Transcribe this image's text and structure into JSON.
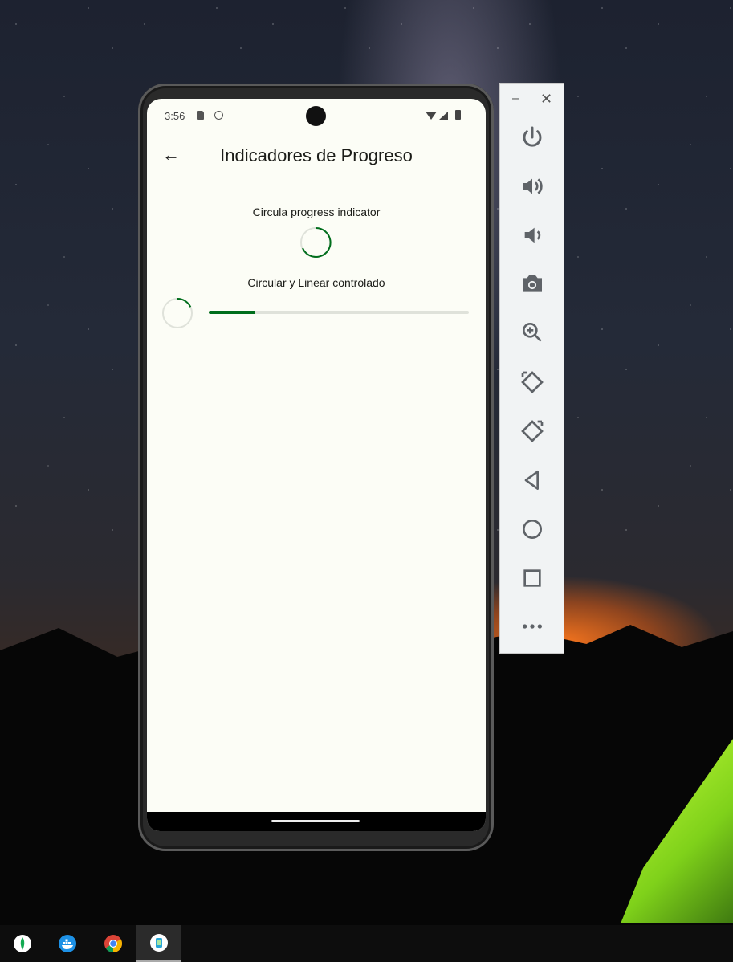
{
  "status_bar": {
    "time": "3:56"
  },
  "app_bar": {
    "title": "Indicadores de Progreso"
  },
  "content": {
    "circular_label": "Circula progress indicator",
    "controlled_label": "Circular y Linear controlado",
    "controlled_progress": 0.18
  },
  "colors": {
    "accent": "#006e1c",
    "track": "#dfe2da",
    "screen_bg": "#fcfdf6"
  },
  "emulator_toolbar": {
    "buttons": [
      "power-icon",
      "volume-up-icon",
      "volume-down-icon",
      "camera-icon",
      "zoom-in-icon",
      "rotate-left-icon",
      "rotate-right-icon",
      "back-icon",
      "home-icon",
      "overview-icon",
      "more-icon"
    ]
  },
  "taskbar": {
    "apps": [
      "mongodb-compass-icon",
      "docker-icon",
      "chrome-icon",
      "android-emulator-icon"
    ],
    "active_index": 3
  }
}
